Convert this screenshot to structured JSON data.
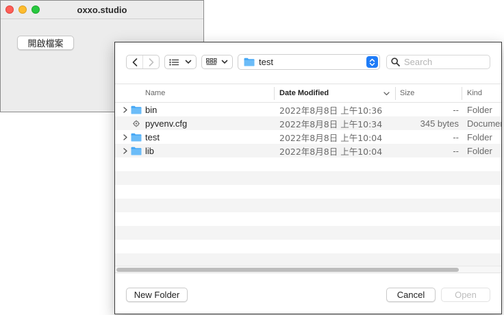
{
  "app": {
    "title": "oxxo.studio",
    "open_button_label": "開啟檔案"
  },
  "dialog": {
    "path": {
      "current": "test"
    },
    "search": {
      "placeholder": "Search",
      "value": ""
    },
    "columns": [
      {
        "label": "Name"
      },
      {
        "label": "Date Modified",
        "sorted": true
      },
      {
        "label": "Size"
      },
      {
        "label": "Kind"
      }
    ],
    "files": [
      {
        "name": "bin",
        "date": "2022年8月8日 上午10:36",
        "size": "--",
        "kind": "Folder",
        "icon": "folder-icon",
        "expandable": true
      },
      {
        "name": "pyvenv.cfg",
        "date": "2022年8月8日 上午10:34",
        "size": "345 bytes",
        "kind": "Documer",
        "icon": "document-icon",
        "expandable": false
      },
      {
        "name": "test",
        "date": "2022年8月8日 上午10:04",
        "size": "--",
        "kind": "Folder",
        "icon": "folder-icon",
        "expandable": true
      },
      {
        "name": "lib",
        "date": "2022年8月8日 上午10:04",
        "size": "--",
        "kind": "Folder",
        "icon": "folder-icon",
        "expandable": true
      }
    ],
    "buttons": {
      "new_folder": "New Folder",
      "cancel": "Cancel",
      "open": "Open"
    },
    "colors": {
      "accent": "#1f7cf7",
      "folder": "#45a7f5"
    }
  }
}
